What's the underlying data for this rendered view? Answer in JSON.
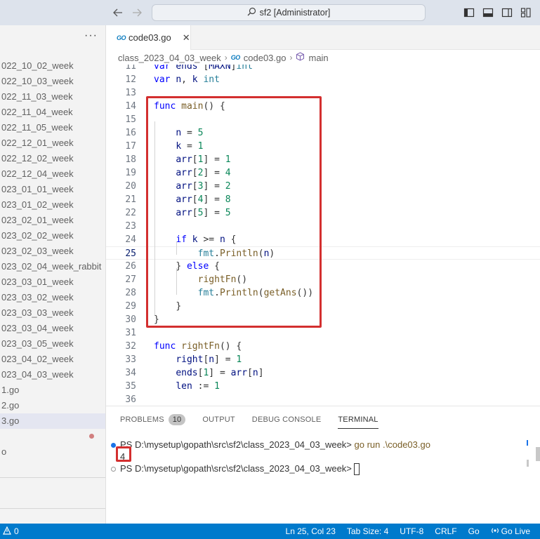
{
  "titlebar": {
    "search_label": "sf2 [Administrator]"
  },
  "sidebar": {
    "items": [
      "022_10_02_week",
      "022_10_03_week",
      "022_11_03_week",
      "022_11_04_week",
      "022_11_05_week",
      "022_12_01_week",
      "022_12_02_week",
      "022_12_04_week",
      "023_01_01_week",
      "023_01_02_week",
      "023_02_01_week",
      "023_02_02_week",
      "023_02_03_week",
      "023_02_04_week_rabbit",
      "023_03_01_week",
      "023_03_02_week",
      "023_03_03_week",
      "023_03_04_week",
      "023_03_05_week",
      "023_04_02_week",
      "023_04_03_week",
      "1.go",
      "2.go",
      "3.go",
      "",
      "o"
    ]
  },
  "tab": {
    "filename": "code03.go",
    "go_badge": "GO",
    "close": "✕"
  },
  "breadcrumb": {
    "folder": "class_2023_04_03_week",
    "file": "code03.go",
    "symbol": "main"
  },
  "editor": {
    "lines": [
      {
        "n": "11",
        "t": "var ends [MAXN]int"
      },
      {
        "n": "12",
        "t": "var n, k int"
      },
      {
        "n": "13",
        "t": ""
      },
      {
        "n": "14",
        "t": "func main() {"
      },
      {
        "n": "15",
        "t": ""
      },
      {
        "n": "16",
        "t": "    n = 5"
      },
      {
        "n": "17",
        "t": "    k = 1"
      },
      {
        "n": "18",
        "t": "    arr[1] = 1"
      },
      {
        "n": "19",
        "t": "    arr[2] = 4"
      },
      {
        "n": "20",
        "t": "    arr[3] = 2"
      },
      {
        "n": "21",
        "t": "    arr[4] = 8"
      },
      {
        "n": "22",
        "t": "    arr[5] = 5"
      },
      {
        "n": "23",
        "t": ""
      },
      {
        "n": "24",
        "t": "    if k >= n {"
      },
      {
        "n": "25",
        "t": "        fmt.Println(n)"
      },
      {
        "n": "26",
        "t": "    } else {"
      },
      {
        "n": "27",
        "t": "        rightFn()"
      },
      {
        "n": "28",
        "t": "        fmt.Println(getAns())"
      },
      {
        "n": "29",
        "t": "    }"
      },
      {
        "n": "30",
        "t": "}"
      },
      {
        "n": "31",
        "t": ""
      },
      {
        "n": "32",
        "t": "func rightFn() {"
      },
      {
        "n": "33",
        "t": "    right[n] = 1"
      },
      {
        "n": "34",
        "t": "    ends[1] = arr[n]"
      },
      {
        "n": "35",
        "t": "    len := 1"
      },
      {
        "n": "36",
        "t": ""
      }
    ],
    "current_line": "25"
  },
  "panel": {
    "tabs": {
      "problems": "PROBLEMS",
      "problems_count": "10",
      "output": "OUTPUT",
      "debug": "DEBUG CONSOLE",
      "terminal": "TERMINAL"
    },
    "terminal": {
      "prompt1": "PS D:\\mysetup\\gopath\\src\\sf2\\class_2023_04_03_week>",
      "command": "go run .\\code03.go",
      "output": "4",
      "prompt2": "PS D:\\mysetup\\gopath\\src\\sf2\\class_2023_04_03_week>"
    }
  },
  "statusbar": {
    "problems": "0",
    "position": "Ln 25, Col 23",
    "tabsize": "Tab Size: 4",
    "encoding": "UTF-8",
    "eol": "CRLF",
    "language": "Go",
    "golive": "Go Live"
  },
  "colors": {
    "accent": "#007acc",
    "highlight_box": "#d32f2f"
  }
}
